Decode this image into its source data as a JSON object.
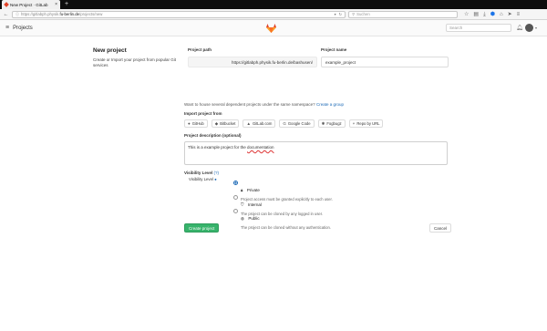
{
  "browser": {
    "tab_title": "New Project · GitLab",
    "tab_close": "×",
    "new_tab": "+",
    "url_prefix": "https://gitlabph.physik.",
    "url_host": "fu-berlin.de",
    "url_path": "/projects/new",
    "search_placeholder": "Suchen"
  },
  "header": {
    "title": "Projects",
    "search_placeholder": "Search"
  },
  "left": {
    "title": "New project",
    "description": "Create or Import your project from popular Git services"
  },
  "form": {
    "path_label": "Project path",
    "path_value": "https://gitlabph.physik.fu-berlin.de/bashusen/",
    "name_label": "Project name",
    "name_value": "example_project",
    "namespace_hint": "Want to house several dependent projects under the same namespace?",
    "namespace_link": "Create a group",
    "import_label": "Import project from",
    "import_buttons": [
      {
        "label": "GitHub",
        "icon": "github-icon"
      },
      {
        "label": "Bitbucket",
        "icon": "bitbucket-icon"
      },
      {
        "label": "GitLab.com",
        "icon": "gitlab-icon"
      },
      {
        "label": "Google Code",
        "icon": "google-icon"
      },
      {
        "label": "Fogbugz",
        "icon": "bug-icon"
      },
      {
        "label": "Repo by URL",
        "icon": "git-icon"
      }
    ],
    "desc_label": "Project description (optional)",
    "desc_value_pre": "This is a example project for the ",
    "desc_value_word": "documentation",
    "visibility_label": "Visibility Level",
    "visibility_help": "(?)",
    "visibility_sub": "Visibility Level",
    "visibility_options": [
      {
        "title": "Private",
        "desc": "Project access must be granted explicitly to each user.",
        "checked": true,
        "icon": "lock-icon"
      },
      {
        "title": "Internal",
        "desc": "The project can be cloned by any logged in user.",
        "checked": false,
        "icon": "shield-icon"
      },
      {
        "title": "Public",
        "desc": "The project can be cloned without any authentication.",
        "checked": false,
        "icon": "globe-icon"
      }
    ],
    "create_label": "Create project",
    "cancel_label": "Cancel"
  },
  "colors": {
    "create_button": "#37b36b",
    "link": "#1b69b6",
    "gitlab_orange": "#e24329"
  }
}
